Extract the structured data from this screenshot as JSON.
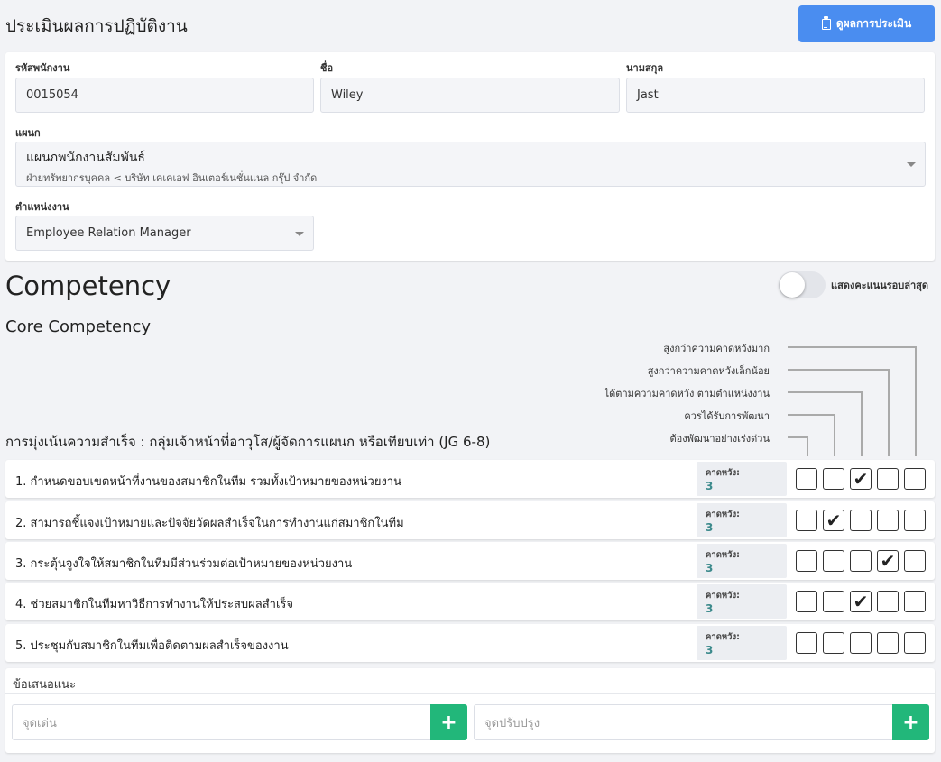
{
  "header": {
    "title": "ประเมินผลการปฏิบัติงาน",
    "view_button": "ดูผลการประเมิน"
  },
  "employee": {
    "id_label": "รหัสพนักงาน",
    "id_value": "0015054",
    "first_name_label": "ชื่อ",
    "first_name_value": "Wiley",
    "last_name_label": "นามสกุล",
    "last_name_value": "Jast",
    "department_label": "แผนก",
    "department_value": "แผนกพนักงานสัมพันธ์",
    "department_path": "ฝ่ายทรัพยากรบุคคล < บริษัท เคเคเอฟ อินเตอร์เนชั่นแนล กรุ๊ป จำกัด",
    "position_label": "ตำแหน่งงาน",
    "position_value": "Employee Relation Manager"
  },
  "competency": {
    "title": "Competency",
    "toggle_label": "แสดงคะแนนรอบล่าสุด",
    "toggle_on": false,
    "core_title": "Core Competency",
    "group_title": "การมุ่งเน้นความสำเร็จ : กลุ่มเจ้าหน้าที่อาวุโส/ผู้จัดการแผนก หรือเทียบเท่า (JG 6-8)",
    "scale_labels": [
      "สูงกว่าความคาดหวังมาก",
      "สูงกว่าความคาดหวังเล็กน้อย",
      "ได้ตามความคาดหวัง ตามตำแหน่งงาน",
      "ควรได้รับการพัฒนา",
      "ต้องพัฒนาอย่างเร่งด่วน"
    ],
    "expected_label": "คาดหวัง:",
    "items": [
      {
        "text": "1. กำหนดขอบเขตหน้าที่งานของสมาชิกในทีม รวมทั้งเป้าหมายของหน่วยงาน",
        "expected": "3",
        "selected": 3
      },
      {
        "text": "2. สามารถชี้แจงเป้าหมายและปัจจัยวัดผลสำเร็จในการทำงานแก่สมาชิกในทีม",
        "expected": "3",
        "selected": 2
      },
      {
        "text": "3. กระตุ้นจูงใจให้สมาชิกในทีมมีส่วนร่วมต่อเป้าหมายของหน่วยงาน",
        "expected": "3",
        "selected": 4
      },
      {
        "text": "4. ช่วยสมาชิกในทีมหาวิธีการทำงานให้ประสบผลสำเร็จ",
        "expected": "3",
        "selected": 3
      },
      {
        "text": "5. ประชุมกับสมาชิกในทีมเพื่อติดตามผลสำเร็จของงาน",
        "expected": "3",
        "selected": 0
      }
    ]
  },
  "suggestion": {
    "label": "ข้อเสนอแนะ",
    "strength_placeholder": "จุดเด่น",
    "improve_placeholder": "จุดปรับปรุง",
    "add_symbol": "+"
  },
  "colors": {
    "primary": "#4a8df0",
    "success": "#22b77a",
    "expected_value": "#3c8a8c"
  }
}
